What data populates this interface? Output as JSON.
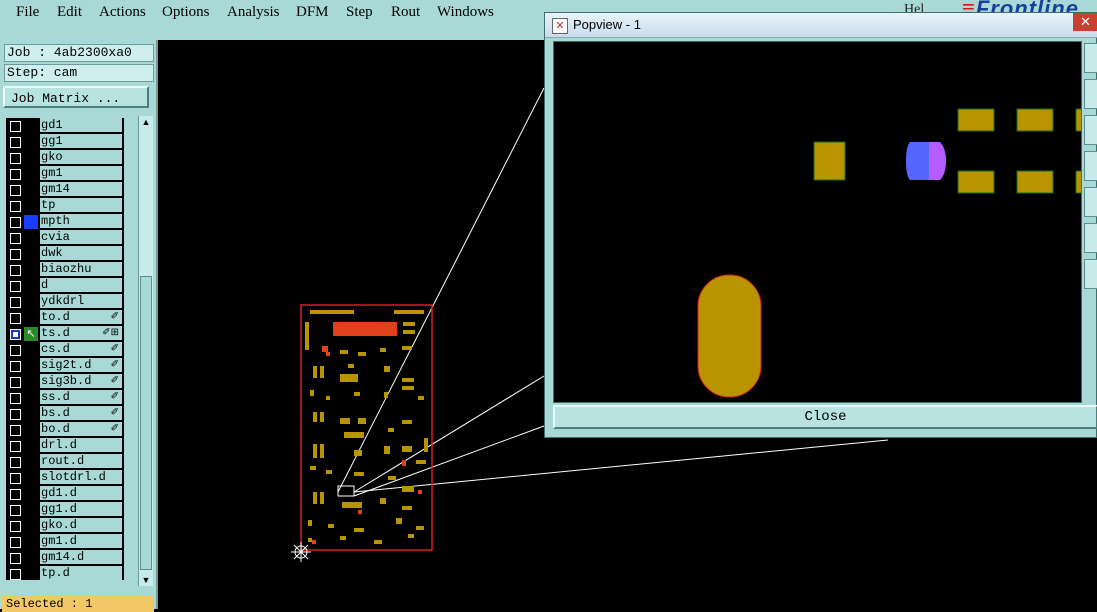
{
  "menubar": {
    "items": [
      "File",
      "Edit",
      "Actions",
      "Options",
      "Analysis",
      "DFM",
      "Step",
      "Rout",
      "Windows"
    ],
    "help": "Hel",
    "logo": "Frontline"
  },
  "left_panel": {
    "job": "Job : 4ab2300xa0",
    "step": "Step: cam",
    "job_matrix_label": "Job Matrix ...",
    "layers": [
      {
        "name": "gd1",
        "checked": false,
        "color": "",
        "flags": ""
      },
      {
        "name": "gg1",
        "checked": false,
        "color": "",
        "flags": ""
      },
      {
        "name": "gko",
        "checked": false,
        "color": "",
        "flags": ""
      },
      {
        "name": "gm1",
        "checked": false,
        "color": "",
        "flags": ""
      },
      {
        "name": "gm14",
        "checked": false,
        "color": "",
        "flags": ""
      },
      {
        "name": "tp",
        "checked": false,
        "color": "",
        "flags": ""
      },
      {
        "name": "mpth",
        "checked": false,
        "color": "#1a3cff",
        "flags": ""
      },
      {
        "name": "cvia",
        "checked": false,
        "color": "",
        "flags": ""
      },
      {
        "name": "dwk",
        "checked": false,
        "color": "",
        "flags": ""
      },
      {
        "name": "biaozhu",
        "checked": false,
        "color": "",
        "flags": ""
      },
      {
        "name": "d",
        "checked": false,
        "color": "",
        "flags": ""
      },
      {
        "name": "ydkdrl",
        "checked": false,
        "color": "",
        "flags": ""
      },
      {
        "name": "to.d",
        "checked": false,
        "color": "",
        "flags": "✐"
      },
      {
        "name": "ts.d",
        "checked": true,
        "color": "#2a8a2a",
        "flags": "✐⊞"
      },
      {
        "name": "cs.d",
        "checked": false,
        "color": "",
        "flags": "✐"
      },
      {
        "name": "sig2t.d",
        "checked": false,
        "color": "",
        "flags": "✐"
      },
      {
        "name": "sig3b.d",
        "checked": false,
        "color": "",
        "flags": "✐"
      },
      {
        "name": "ss.d",
        "checked": false,
        "color": "",
        "flags": "✐"
      },
      {
        "name": "bs.d",
        "checked": false,
        "color": "",
        "flags": "✐"
      },
      {
        "name": "bo.d",
        "checked": false,
        "color": "",
        "flags": "✐"
      },
      {
        "name": "drl.d",
        "checked": false,
        "color": "",
        "flags": ""
      },
      {
        "name": "rout.d",
        "checked": false,
        "color": "",
        "flags": ""
      },
      {
        "name": "slotdrl.d",
        "checked": false,
        "color": "",
        "flags": ""
      },
      {
        "name": "gd1.d",
        "checked": false,
        "color": "",
        "flags": ""
      },
      {
        "name": "gg1.d",
        "checked": false,
        "color": "",
        "flags": ""
      },
      {
        "name": "gko.d",
        "checked": false,
        "color": "",
        "flags": ""
      },
      {
        "name": "gm1.d",
        "checked": false,
        "color": "",
        "flags": ""
      },
      {
        "name": "gm14.d",
        "checked": false,
        "color": "",
        "flags": ""
      },
      {
        "name": "tp.d",
        "checked": false,
        "color": "",
        "flags": ""
      }
    ],
    "status": "Selected : 1"
  },
  "popview": {
    "title": "Popview - 1",
    "close_label": "Close",
    "close_x": "✕"
  },
  "colors": {
    "panel": "#a9d9d6",
    "pad": "#b89400",
    "pad_outline": "#1d6b1d",
    "board_outline": "#d42020",
    "selected_pad_blue": "#5566ff",
    "selected_pad_violet": "#b45cff"
  }
}
